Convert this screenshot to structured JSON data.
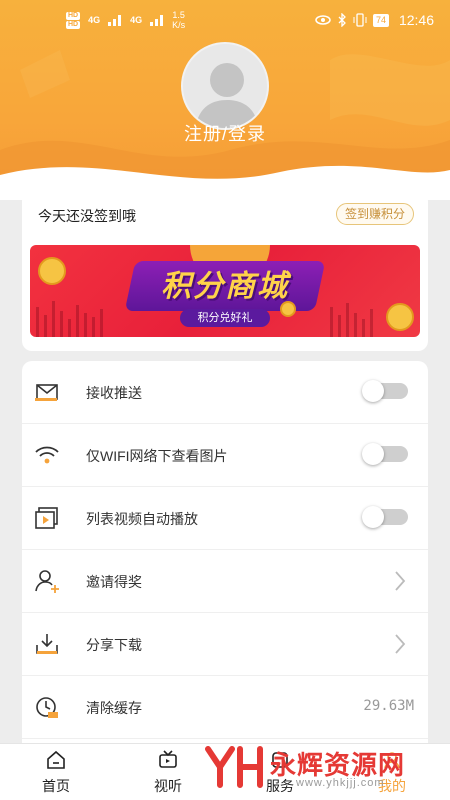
{
  "status_bar": {
    "hd1": "HD",
    "hd2": "HD",
    "signal1": "4G",
    "signal2": "4G",
    "speed_value": "1.5",
    "speed_unit": "K/s",
    "battery": "74",
    "time": "12:46",
    "icons": [
      "eye-icon",
      "bluetooth-icon",
      "vibrate-icon",
      "battery-icon"
    ]
  },
  "profile": {
    "avatar_icon": "default-avatar-icon",
    "login_label": "注册/登录"
  },
  "signin_card": {
    "title": "今天还没签到哦",
    "button": "签到赚积分",
    "banner_title": "积分商城",
    "banner_subtitle": "积分兑好礼"
  },
  "settings": [
    {
      "icon": "envelope-icon",
      "label": "接收推送",
      "control": "toggle",
      "on": false
    },
    {
      "icon": "wifi-icon",
      "label": "仅WIFI网络下查看图片",
      "control": "toggle",
      "on": false
    },
    {
      "icon": "video-play-icon",
      "label": "列表视频自动播放",
      "control": "toggle",
      "on": false
    },
    {
      "icon": "add-user-icon",
      "label": "邀请得奖",
      "control": "chevron"
    },
    {
      "icon": "download-icon",
      "label": "分享下载",
      "control": "chevron"
    },
    {
      "icon": "clear-cache-icon",
      "label": "清除缓存",
      "control": "value",
      "value": "29.63M"
    }
  ],
  "bottom_nav": [
    {
      "icon": "home-icon",
      "label": "首页",
      "active": false
    },
    {
      "icon": "tv-icon",
      "label": "视听",
      "active": false
    },
    {
      "icon": "service-icon",
      "label": "服务",
      "active": false
    },
    {
      "icon": "profile-icon",
      "label": "我的",
      "active": true
    }
  ],
  "watermark": {
    "logo": "YH",
    "text": "永辉资源网",
    "url": "www.yhkjjj.com"
  },
  "colors": {
    "header_orange": "#f7a83b",
    "accent": "#f5a33b",
    "banner_red": "#e8203a",
    "banner_purple": "#5b1a9e"
  }
}
